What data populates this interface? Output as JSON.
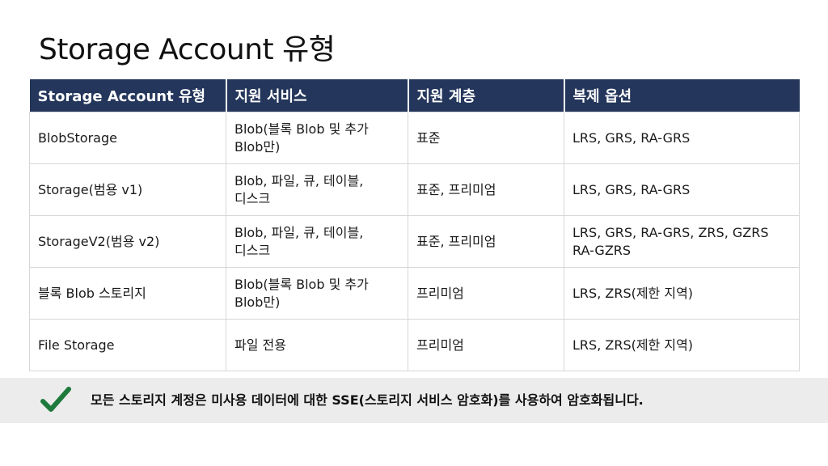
{
  "slide": {
    "title": "Storage Account 유형"
  },
  "table": {
    "headers": [
      "Storage Account 유형",
      "지원 서비스",
      "지원 계층",
      "복제 옵션"
    ],
    "rows": [
      {
        "account_type": "BlobStorage",
        "services": [
          "Blob(블록 Blob 및 추가",
          "Blob만)"
        ],
        "tiers": "표준",
        "replication": [
          "LRS, GRS, RA-GRS"
        ]
      },
      {
        "account_type": "Storage(범용 v1)",
        "services": [
          "Blob, 파일, 큐, 테이블,",
          "디스크"
        ],
        "tiers": "표준, 프리미엄",
        "replication": [
          "LRS, GRS, RA-GRS"
        ]
      },
      {
        "account_type": "StorageV2(범용 v2)",
        "services": [
          "Blob, 파일, 큐, 테이블,",
          "디스크"
        ],
        "tiers": "표준, 프리미엄",
        "replication": [
          "LRS, GRS, RA-GRS, ZRS, GZRS",
          "RA-GZRS"
        ]
      },
      {
        "account_type": "블록 Blob 스토리지",
        "services": [
          "Blob(블록 Blob 및 추가",
          "Blob만)"
        ],
        "tiers": "프리미엄",
        "replication": [
          "LRS, ZRS(제한 지역)"
        ]
      },
      {
        "account_type": "File Storage",
        "services": [
          "파일 전용"
        ],
        "tiers": "프리미엄",
        "replication": [
          "LRS, ZRS(제한 지역)"
        ]
      }
    ]
  },
  "footer": {
    "icon": "checkmark-icon",
    "note": "모든 스토리지 계정은 미사용 데이터에 대한 SSE(스토리지 서비스 암호화)를 사용하여 암호화됩니다."
  },
  "colors": {
    "header_bg": "#24365b",
    "header_text": "#ffffff",
    "check_green": "#1e7a3c",
    "footer_band": "#ececec",
    "cell_border": "#d7d7d7"
  }
}
